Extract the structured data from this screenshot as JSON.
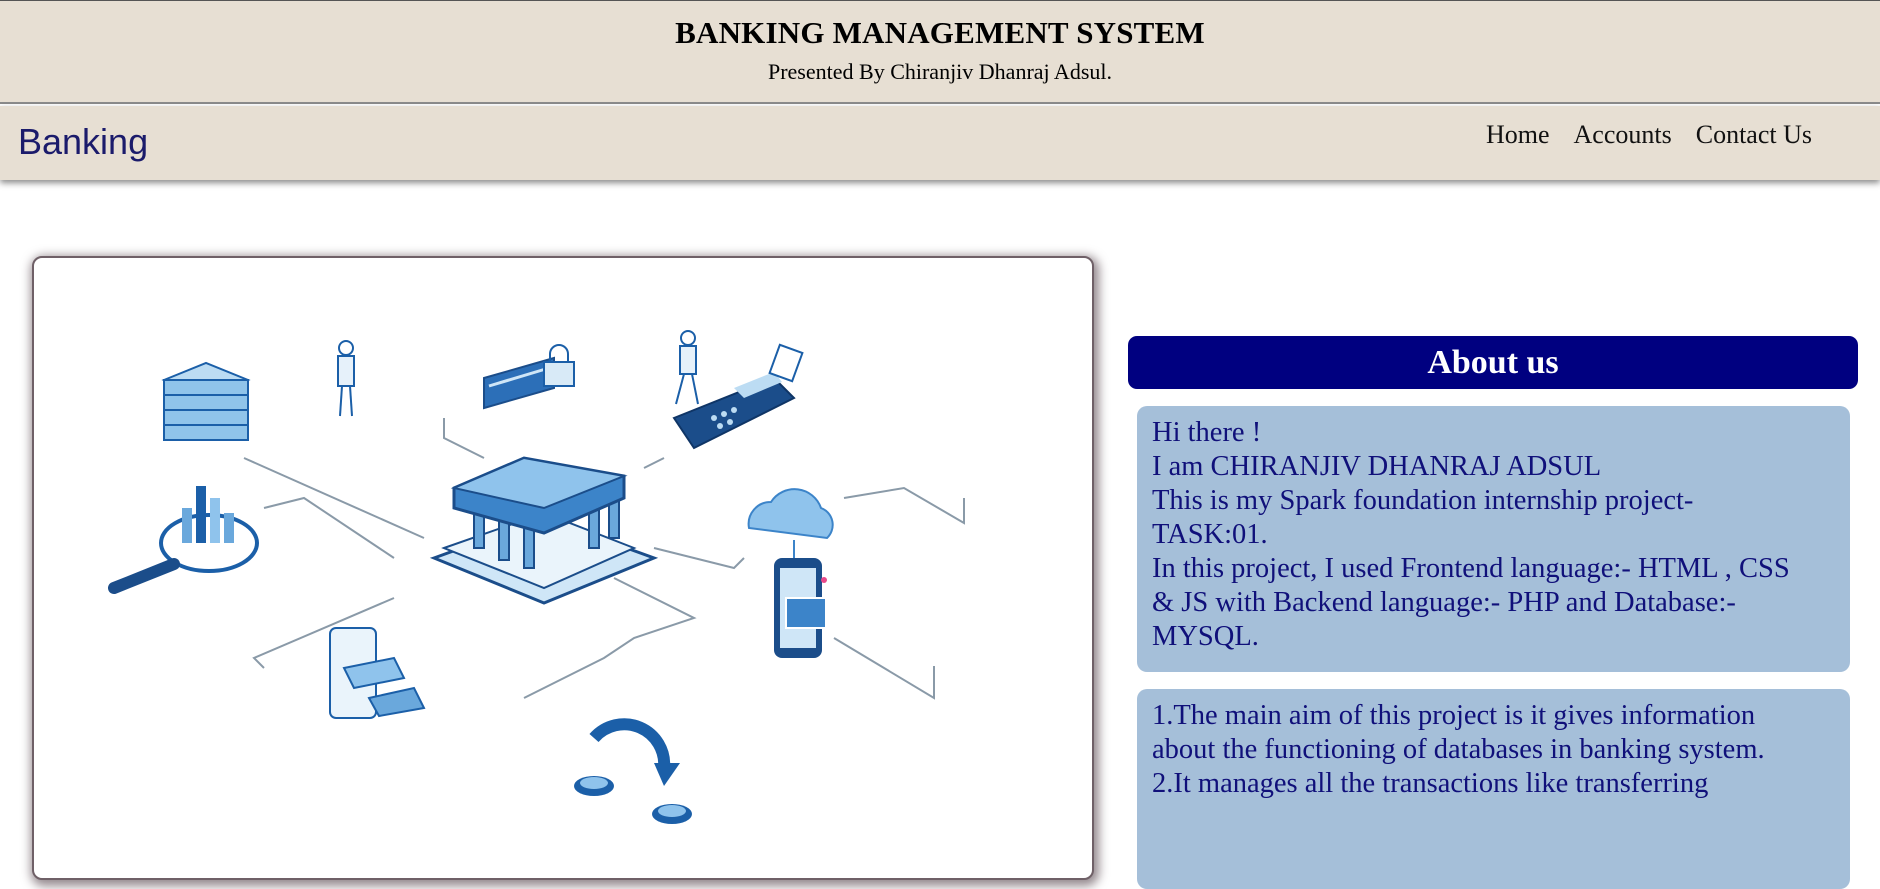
{
  "header": {
    "title": "BANKING MANAGEMENT SYSTEM",
    "subtitle": "Presented By Chiranjiv Dhanraj Adsul."
  },
  "navbar": {
    "brand": "Banking",
    "links": [
      "Home",
      "Accounts",
      "Contact Us"
    ]
  },
  "about": {
    "heading": "About us",
    "intro_lines": [
      "Hi there !",
      "I am CHIRANJIV DHANRAJ ADSUL",
      "This is my Spark foundation internship project-",
      "TASK:01.",
      "In this project, I used Frontend language:- HTML , CSS",
      "& JS with Backend language:- PHP and Database:-",
      "MYSQL."
    ],
    "aims_lines": [
      "1.The main aim of this project is it gives information",
      "about the functioning of databases in banking system.",
      "2.It manages all the transactions like transferring"
    ]
  },
  "colors": {
    "header_bg": "#e7dfd3",
    "brand": "#1b1b6b",
    "about_header_bg": "#000080",
    "info_box_bg": "#a5bfd9",
    "info_text": "#10107a"
  },
  "icons": [
    "database-icon",
    "analytics-magnifier-icon",
    "bank-building-icon",
    "card-lock-icon",
    "pos-terminal-icon",
    "cloud-icon",
    "mobile-payment-icon",
    "atm-card-icon",
    "coin-transfer-icon",
    "person-icon"
  ]
}
